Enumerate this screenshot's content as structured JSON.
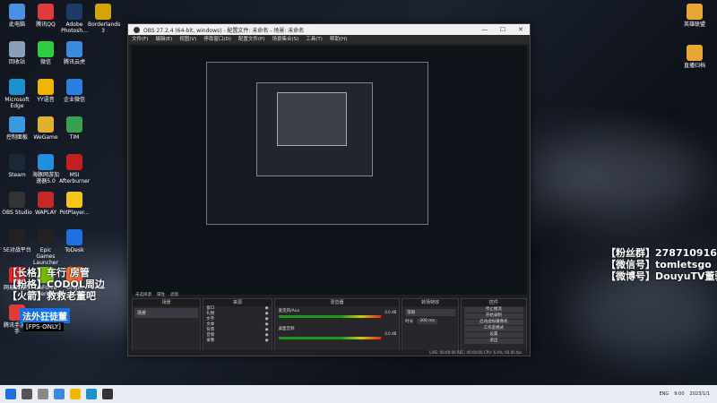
{
  "desktop": {
    "icons_left": [
      {
        "label": "此电脑",
        "color": "#4a8fe0"
      },
      {
        "label": "腾讯QQ",
        "color": "#e03a3a"
      },
      {
        "label": "Adobe Photosh...",
        "color": "#1f3a66"
      },
      {
        "label": "Borderlands 3",
        "color": "#d6a400"
      },
      {
        "label": "回收站",
        "color": "#8aa0b8"
      },
      {
        "label": "微信",
        "color": "#2ecc40"
      },
      {
        "label": "腾讯云虎",
        "color": "#3a8ae0"
      },
      {
        "label": "Microsoft Edge",
        "color": "#1f8fce"
      },
      {
        "label": "YY语音",
        "color": "#f0b400"
      },
      {
        "label": "企业微信",
        "color": "#2a80e0"
      },
      {
        "label": "控制面板",
        "color": "#3a9ae0"
      },
      {
        "label": "WeGame",
        "color": "#e0b030"
      },
      {
        "label": "TIM",
        "color": "#3aa050"
      },
      {
        "label": "Steam",
        "color": "#1b2838"
      },
      {
        "label": "海豚网游加速器5.0",
        "color": "#1f8fde"
      },
      {
        "label": "MSI Afterburner",
        "color": "#c02020"
      },
      {
        "label": "OBS Studio",
        "color": "#333"
      },
      {
        "label": "WAPLAY",
        "color": "#c62828"
      },
      {
        "label": "PotPlayer...",
        "color": "#f5c518"
      },
      {
        "label": "5E对战平台",
        "color": "#222"
      },
      {
        "label": "Epic Games Launcher",
        "color": "#222"
      },
      {
        "label": "ToDesk",
        "color": "#1f6fe0"
      },
      {
        "label": "网易云音乐",
        "color": "#e02a2a"
      },
      {
        "label": "GeForce Experience",
        "color": "#76b900"
      },
      {
        "label": "Origin",
        "color": "#f56c2d"
      },
      {
        "label": "腾讯手游助手",
        "color": "#e03a3a"
      }
    ],
    "icons_right": [
      {
        "label": "英雄联盟",
        "color": "#e8a634"
      },
      {
        "label": "直播归档",
        "color": "#e8a634"
      }
    ],
    "overlay_left": [
      "【长格】车行 房管",
      "【粉格】CODOL周边",
      "【火箭】救救老董吧"
    ],
    "badge_text": "法外狂徒董",
    "fps_text": "[FPS-ONLY]",
    "overlay_right": [
      "【粉丝群】278710916",
      "【微信号】tomletsgo",
      "【微博号】DouyuTV董驴"
    ]
  },
  "obs": {
    "title": "OBS 27.2.4 (64-bit, windows) - 配置文件: 未命名 - 场景: 未命名",
    "menu": [
      "文件(F)",
      "编辑(E)",
      "视图(V)",
      "停靠窗口(D)",
      "配置文件(P)",
      "场景集合(S)",
      "工具(T)",
      "帮助(H)"
    ],
    "window_controls": [
      "—",
      "☐",
      "✕"
    ],
    "tabs": [
      "未选择源",
      "属性",
      "滤镜"
    ],
    "panels": {
      "scenes": {
        "header": "场景",
        "items": [
          "场景"
        ]
      },
      "sources": {
        "header": "来源",
        "items": [
          "窗口",
          "礼物",
          "文字",
          "文本",
          "背景",
          "音频",
          "录像"
        ]
      },
      "mixer": {
        "header": "混音器",
        "tracks": [
          {
            "name": "麦克风/Aux",
            "db": "0.0 dB"
          },
          {
            "name": "桌面音频",
            "db": "0.0 dB"
          }
        ]
      },
      "transitions": {
        "header": "转场特效",
        "fade": "渐隐",
        "duration_label": "时长",
        "duration": "300 ms"
      },
      "controls": {
        "header": "控件",
        "buttons": [
          "停止推流",
          "开始录制",
          "启动虚拟摄像机",
          "工作室模式",
          "设置",
          "退出"
        ]
      }
    },
    "status": "LIVE: 00:00:00   REC: 00:00:00   CPU: 6.4%, 60.00 fps"
  },
  "taskbar": {
    "tray": [
      "ENG",
      "9:00",
      "2023/1/1"
    ]
  }
}
